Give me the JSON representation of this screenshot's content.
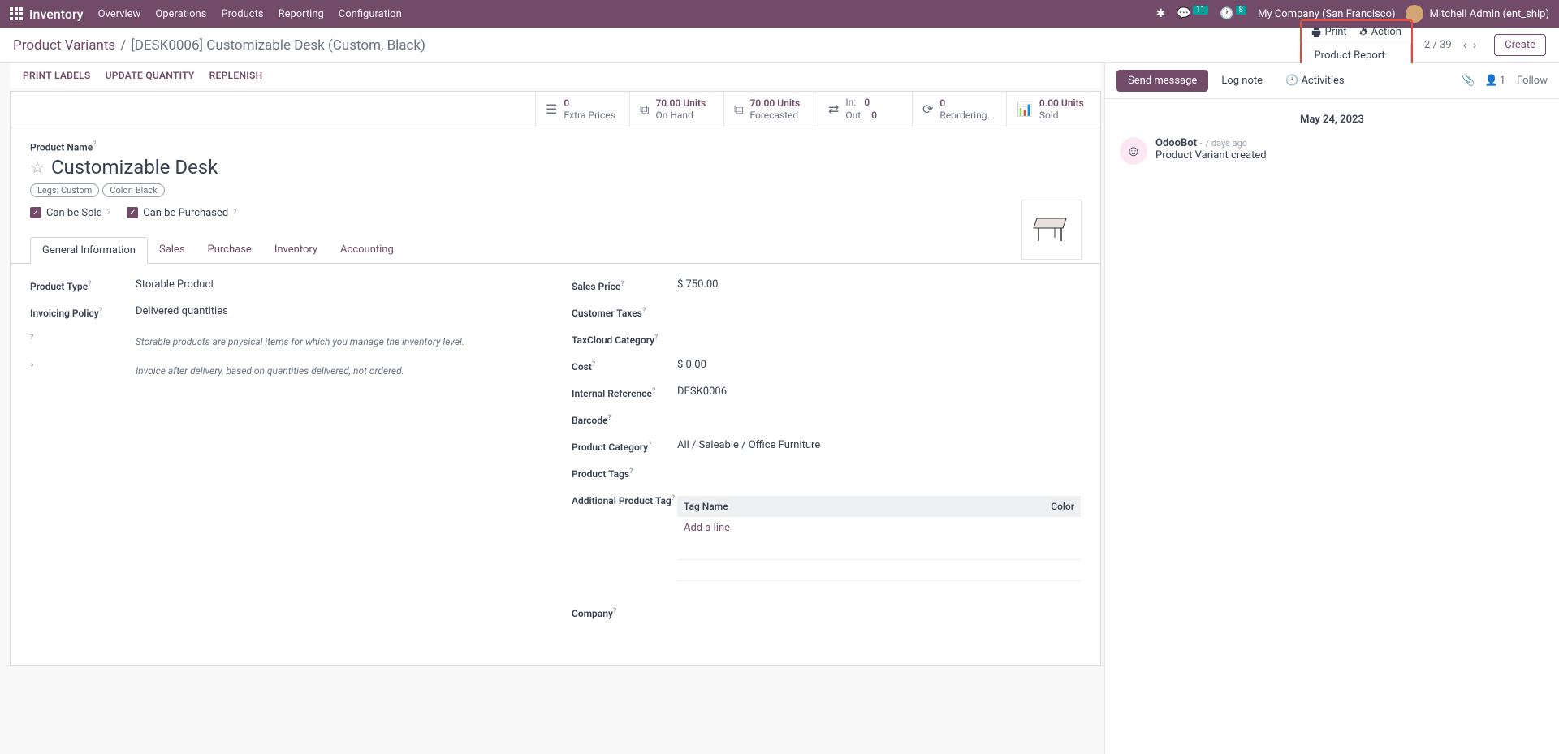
{
  "topbar": {
    "app": "Inventory",
    "nav": [
      "Overview",
      "Operations",
      "Products",
      "Reporting",
      "Configuration"
    ],
    "chat_badge": "11",
    "clock_badge": "8",
    "company": "My Company (San Francisco)",
    "user": "Mitchell Admin (ent_ship)"
  },
  "breadcrumb": {
    "parent": "Product Variants",
    "title": "[DESK0006] Customizable Desk (Custom, Black)"
  },
  "controls": {
    "print": "Print",
    "action": "Action",
    "dropdown_item": "Product Report",
    "pager": "2 / 39",
    "create": "Create"
  },
  "quick_actions": [
    "PRINT LABELS",
    "UPDATE QUANTITY",
    "REPLENISH"
  ],
  "stats": {
    "extra_prices": {
      "val": "0",
      "lbl": "Extra Prices"
    },
    "on_hand": {
      "val": "70.00 Units",
      "lbl": "On Hand"
    },
    "forecasted": {
      "val": "70.00 Units",
      "lbl": "Forecasted"
    },
    "in": {
      "lbl": "In:",
      "val": "0"
    },
    "out": {
      "lbl": "Out:",
      "val": "0"
    },
    "reorder": {
      "val": "0",
      "lbl": "Reordering..."
    },
    "sold": {
      "val": "0.00 Units",
      "lbl": "Sold"
    }
  },
  "product": {
    "name_label": "Product Name",
    "name": "Customizable Desk",
    "variant_tags": [
      "Legs: Custom",
      "Color: Black"
    ],
    "can_sold": "Can be Sold",
    "can_purchased": "Can be Purchased"
  },
  "tabs": [
    "General Information",
    "Sales",
    "Purchase",
    "Inventory",
    "Accounting"
  ],
  "form_left": {
    "product_type": {
      "lbl": "Product Type",
      "val": "Storable Product"
    },
    "invoicing": {
      "lbl": "Invoicing Policy",
      "val": "Delivered quantities"
    },
    "hint1": "Storable products are physical items for which you manage the inventory level.",
    "hint2": "Invoice after delivery, based on quantities delivered, not ordered."
  },
  "form_right": {
    "sales_price": {
      "lbl": "Sales Price",
      "val": "$ 750.00"
    },
    "customer_taxes": {
      "lbl": "Customer Taxes",
      "val": ""
    },
    "taxcloud": {
      "lbl": "TaxCloud Category",
      "val": ""
    },
    "cost": {
      "lbl": "Cost",
      "val": "$ 0.00"
    },
    "internal_ref": {
      "lbl": "Internal Reference",
      "val": "DESK0006"
    },
    "barcode": {
      "lbl": "Barcode",
      "val": ""
    },
    "category": {
      "lbl": "Product Category",
      "val": "All / Saleable / Office Furniture"
    },
    "tags": {
      "lbl": "Product Tags",
      "val": ""
    },
    "additional_tag": {
      "lbl": "Additional Product Tag"
    },
    "tag_cols": [
      "Tag Name",
      "Color"
    ],
    "add_line": "Add a line",
    "company": {
      "lbl": "Company",
      "val": ""
    }
  },
  "chatter": {
    "send": "Send message",
    "log": "Log note",
    "activities": "Activities",
    "followers": "1",
    "follow": "Follow",
    "date": "May 24, 2023",
    "msg_author": "OdooBot",
    "msg_time": "- 7 days ago",
    "msg_body": "Product Variant created"
  }
}
